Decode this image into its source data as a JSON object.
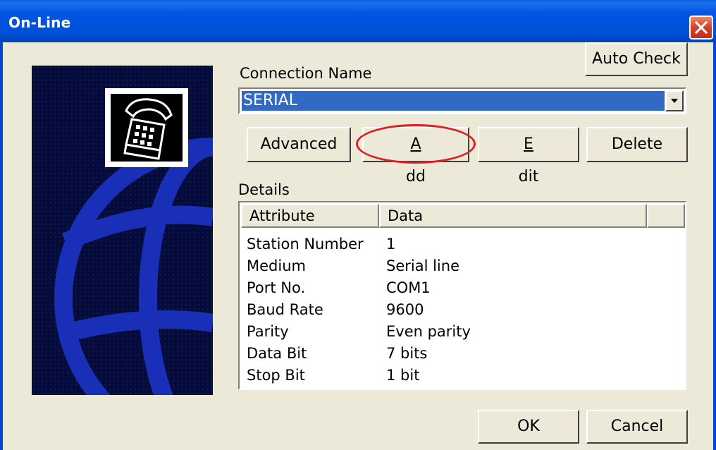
{
  "window": {
    "title": "On-Line",
    "close_icon": "close-x-icon"
  },
  "buttons": {
    "auto_check": "Auto Check",
    "advanced": "Advanced",
    "add": {
      "pre": "",
      "u": "A",
      "post": "dd"
    },
    "edit": {
      "pre": "",
      "u": "E",
      "post": "dit"
    },
    "delete": "Delete",
    "ok": "OK",
    "cancel": "Cancel"
  },
  "connection": {
    "label": "Connection Name",
    "selected": "SERIAL"
  },
  "details": {
    "label": "Details",
    "columns": [
      "Attribute",
      "Data"
    ],
    "rows": [
      {
        "attribute": "Station Number",
        "data": "1"
      },
      {
        "attribute": "Medium",
        "data": "Serial line"
      },
      {
        "attribute": "Port No.",
        "data": "COM1"
      },
      {
        "attribute": "Baud Rate",
        "data": "9600"
      },
      {
        "attribute": "Parity",
        "data": "Even parity"
      },
      {
        "attribute": "Data Bit",
        "data": "7 bits"
      },
      {
        "attribute": "Stop Bit",
        "data": "1 bit"
      }
    ]
  },
  "colors": {
    "title_bar": "#0054e3",
    "selection": "#316ac5",
    "annotation": "#e02020",
    "panel_bg": "#050c3a",
    "globe": "#1a2fb8"
  },
  "icons": {
    "telephone": "telephone-icon",
    "globe": "globe-graphic",
    "dropdown": "chevron-down-icon"
  }
}
